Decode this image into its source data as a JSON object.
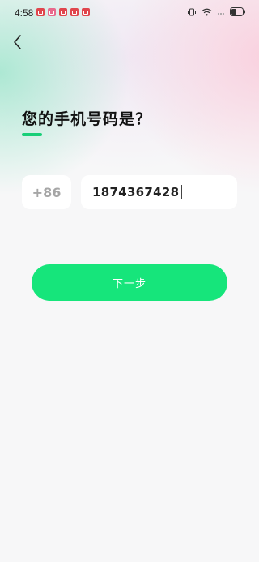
{
  "status_bar": {
    "time": "4:58"
  },
  "page": {
    "title": "您的手机号码是？",
    "accent_color": "#19cf78"
  },
  "form": {
    "country_code": "+86",
    "phone_value": "1874367428"
  },
  "actions": {
    "next_label": "下一步",
    "button_color": "#16e57b"
  },
  "icons": [
    "back-arrow-icon",
    "vibrate-icon",
    "wifi-icon",
    "battery-icon"
  ]
}
